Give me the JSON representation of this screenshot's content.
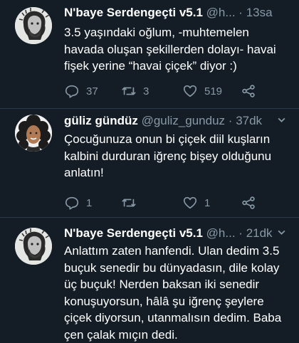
{
  "tweets": [
    {
      "name": "N'baye Serdengeçti v5.1",
      "handle": "@h...",
      "dot": "·",
      "time": "13sa",
      "lines": [
        "3.5 yaşındaki oğlum, -muhtemelen",
        "havada oluşan şekillerden dolayı- havai",
        "fişek yerine “havai çiçek” diyor :)"
      ],
      "replies": "37",
      "retweets": "3",
      "likes": "519",
      "avatar_icon": "sketch-portrait-avatar"
    },
    {
      "name": "güliz gündüz",
      "handle": "@guliz_gunduz",
      "dot": "·",
      "time": "37dk",
      "lines": [
        "Çocuğunuza onun bi çiçek diil kuşların",
        "kalbini durduran iğrenç bişey olduğunu",
        "anlatın!"
      ],
      "replies": "1",
      "retweets": "",
      "likes": "1",
      "avatar_icon": "curly-hair-portrait-avatar"
    },
    {
      "name": "N'baye Serdengeçti v5.1",
      "handle": "@h...",
      "dot": "·",
      "time": "21dk",
      "lines": [
        "Anlattım zaten hanfendi. Ulan dedim 3.5",
        "buçuk senedir bu dünyadasın, dile kolay",
        "üç buçuk! Nerden baksan iki senedir",
        "konuşuyorsun, hâlâ şu iğrenç şeylere",
        "çiçek diyorsun, utanmalısın dedim. Baba",
        "çen çalak mıçın dedi."
      ],
      "avatar_icon": "sketch-portrait-avatar"
    }
  ],
  "colors": {
    "background": "#141d26",
    "secondary_text": "#8899a6",
    "divider": "#2b3a48"
  },
  "icons": {
    "reply": "reply-icon",
    "retweet": "retweet-icon",
    "like": "heart-icon",
    "share": "share-icon",
    "menu": "chevron-down-icon"
  }
}
